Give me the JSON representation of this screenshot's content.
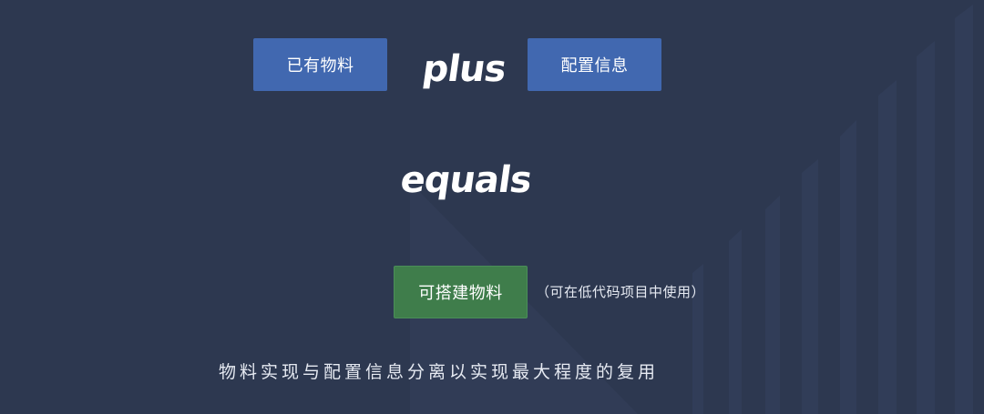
{
  "inputs": [
    {
      "label": "已有物料"
    },
    {
      "label": "配置信息"
    }
  ],
  "operator": "plus",
  "equals": "equals",
  "result": {
    "label": "可搭建物料",
    "note": "（可在低代码项目中使用）"
  },
  "caption": "物料实现与配置信息分离以实现最大程度的复用",
  "colors": {
    "background": "#2d3850",
    "input_box": "#4168b0",
    "result_box": "#3f7d4b",
    "text": "#ffffff"
  }
}
